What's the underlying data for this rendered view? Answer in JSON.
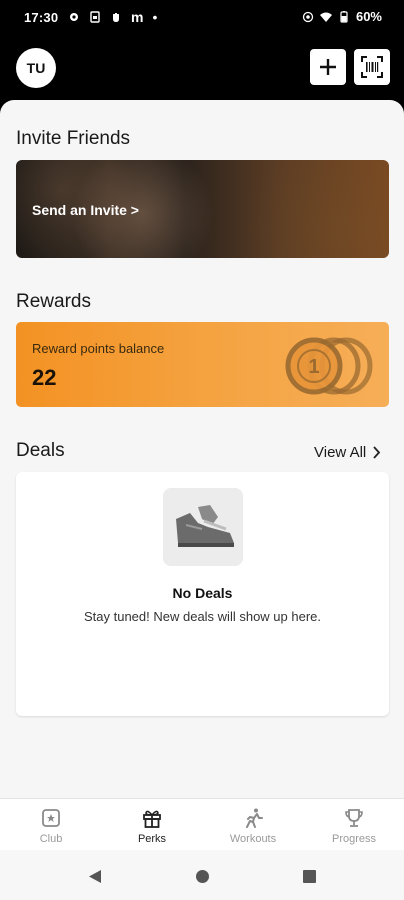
{
  "status_bar": {
    "time": "17:30",
    "battery": "60%",
    "left_icons": [
      "settings-icon",
      "sim-icon",
      "hand-icon",
      "m-icon",
      "dot-icon"
    ],
    "right_icons": [
      "vibrate-icon",
      "wifi-icon",
      "battery-icon"
    ]
  },
  "header": {
    "avatar_initials": "TU",
    "add_icon": "plus-icon",
    "scan_icon": "barcode-scan-icon"
  },
  "invite": {
    "section_title": "Invite Friends",
    "banner_label": "Send an Invite >"
  },
  "rewards": {
    "section_title": "Rewards",
    "balance_label": "Reward points balance",
    "balance_value": "22",
    "coin_number": "1"
  },
  "deals": {
    "section_title": "Deals",
    "view_all_label": "View All",
    "empty_title": "No Deals",
    "empty_subtitle": "Stay tuned! New deals will show up here."
  },
  "bottom_nav": {
    "items": [
      {
        "label": "Club",
        "icon": "club-icon",
        "active": false
      },
      {
        "label": "Perks",
        "icon": "gift-icon",
        "active": true
      },
      {
        "label": "Workouts",
        "icon": "running-icon",
        "active": false
      },
      {
        "label": "Progress",
        "icon": "trophy-icon",
        "active": false
      }
    ]
  },
  "colors": {
    "accent_orange": "#f39223",
    "header_bg": "#000000",
    "sheet_bg": "#f6f6f6"
  }
}
